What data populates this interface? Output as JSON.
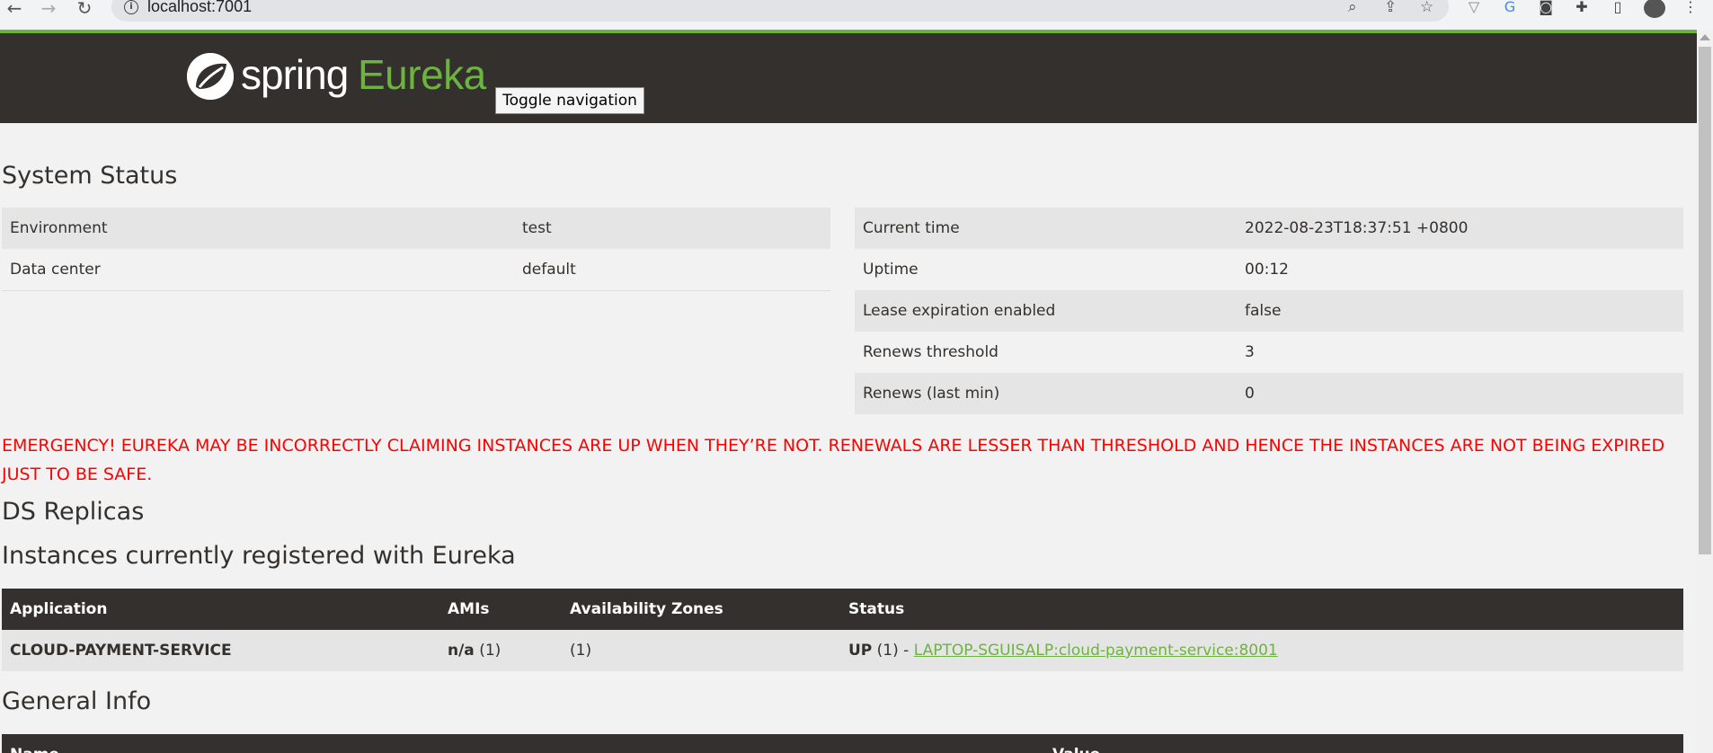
{
  "browser": {
    "url": "localhost:7001"
  },
  "header": {
    "logo_spring": "spring",
    "logo_eureka": "Eureka",
    "toggle_label": "Toggle navigation",
    "brand_color": "#6db33f",
    "bar_color": "#34302d"
  },
  "system_status": {
    "title": "System Status",
    "left": [
      {
        "label": "Environment",
        "value": "test"
      },
      {
        "label": "Data center",
        "value": "default"
      }
    ],
    "right": [
      {
        "label": "Current time",
        "value": "2022-08-23T18:37:51 +0800"
      },
      {
        "label": "Uptime",
        "value": "00:12"
      },
      {
        "label": "Lease expiration enabled",
        "value": "false"
      },
      {
        "label": "Renews threshold",
        "value": "3"
      },
      {
        "label": "Renews (last min)",
        "value": "0"
      }
    ]
  },
  "emergency": {
    "text": "EMERGENCY! EUREKA MAY BE INCORRECTLY CLAIMING INSTANCES ARE UP WHEN THEY’RE NOT. RENEWALS ARE LESSER THAN THRESHOLD AND HENCE THE INSTANCES ARE NOT BEING EXPIRED JUST TO BE SAFE.",
    "color": "#ff0000"
  },
  "ds_replicas": {
    "title": "DS Replicas"
  },
  "instances": {
    "title": "Instances currently registered with Eureka",
    "columns": [
      "Application",
      "AMIs",
      "Availability Zones",
      "Status"
    ],
    "rows": [
      {
        "application": "CLOUD-PAYMENT-SERVICE",
        "amis_bold": "n/a",
        "amis_count": "(1)",
        "zones": "(1)",
        "status_bold": "UP",
        "status_count": "(1) -",
        "instance_link": "LAPTOP-SGUISALP:cloud-payment-service:8001"
      }
    ]
  },
  "general_info": {
    "title": "General Info",
    "columns": [
      "Name",
      "Value"
    ]
  }
}
